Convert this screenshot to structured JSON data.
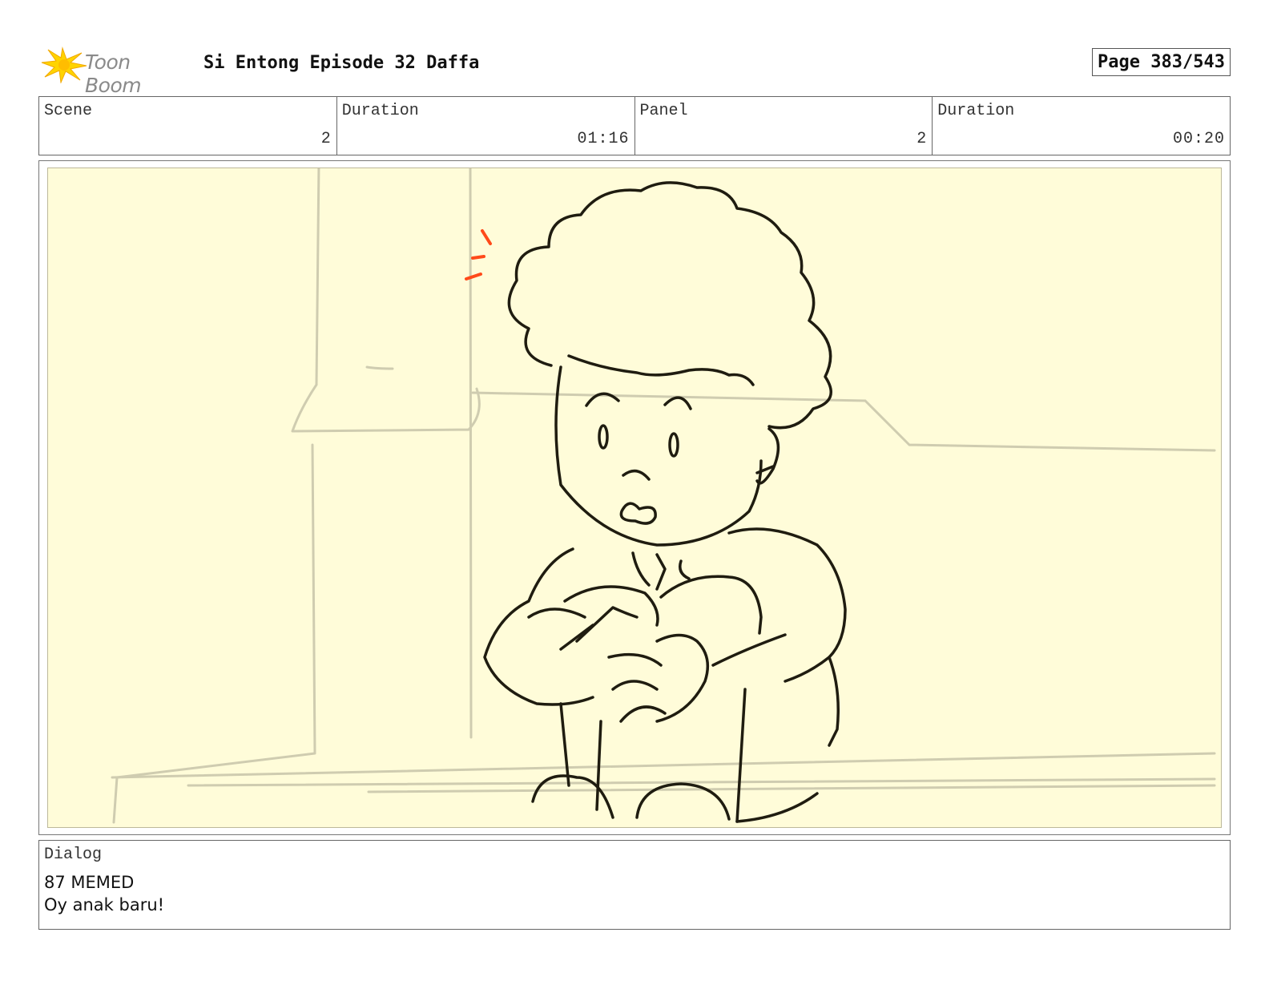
{
  "header": {
    "logo_text": "Toon Boom",
    "title": "Si Entong Episode 32 Daffa",
    "page": "Page 383/543"
  },
  "info": {
    "scene_label": "Scene",
    "scene_value": "2",
    "duration_label": "Duration",
    "duration_value": "01:16",
    "panel_label": "Panel",
    "panel_value": "2",
    "panel_duration_label": "Duration",
    "panel_duration_value": "00:20"
  },
  "dialog": {
    "label": "Dialog",
    "speaker": "87 MEMED",
    "line": "Oy anak baru!"
  },
  "colors": {
    "panel_bg": "#fffcd9",
    "sketch_line": "#1f1c10",
    "background_line": "#cfccb0",
    "accent_mark": "#ff4a1a",
    "logo_flare": "#ffd400"
  }
}
